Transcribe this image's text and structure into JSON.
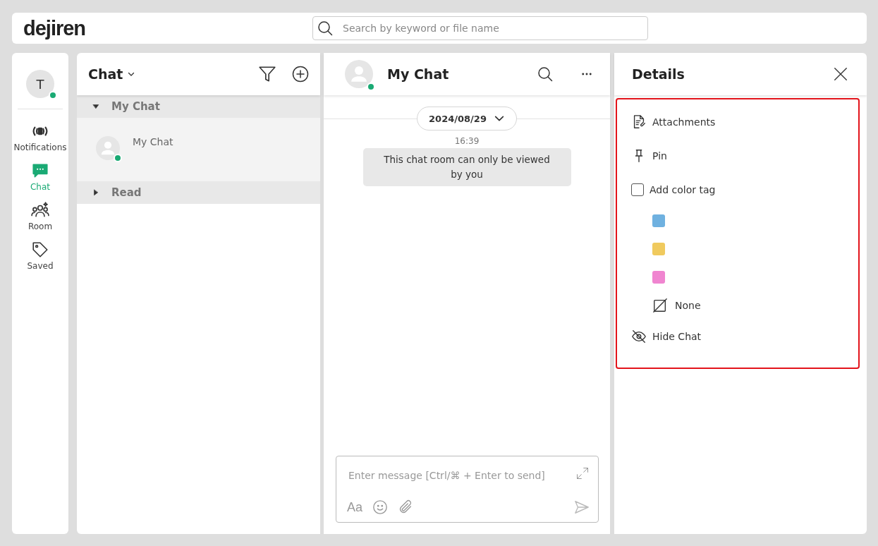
{
  "header": {
    "logo": "dejiren",
    "search": {
      "placeholder": "Search by keyword or file name"
    }
  },
  "nav": {
    "avatar": {
      "initial": "T",
      "online": true
    },
    "items": [
      {
        "kind": "notifications",
        "label": "Notifications",
        "selected": false
      },
      {
        "kind": "chat",
        "label": "Chat",
        "selected": true
      },
      {
        "kind": "room",
        "label": "Room",
        "selected": false
      },
      {
        "kind": "saved",
        "label": "Saved",
        "selected": false
      }
    ]
  },
  "chat_list": {
    "title": "Chat",
    "groups": [
      {
        "label": "My Chat",
        "expanded": true,
        "items": [
          {
            "name": "My Chat",
            "online": true,
            "selected": true
          }
        ]
      },
      {
        "label": "Read",
        "expanded": false
      }
    ]
  },
  "conversation": {
    "title": "My Chat",
    "online": true,
    "date": "2024/08/29",
    "messages": [
      {
        "time": "16:39",
        "text": "This chat room can only be viewed by you"
      }
    ],
    "composer": {
      "placeholder": "Enter message [Ctrl/⌘ + Enter to send]",
      "format_label": "Aa"
    }
  },
  "details": {
    "title": "Details",
    "highlighted": true,
    "items": [
      {
        "kind": "attachments",
        "label": "Attachments"
      },
      {
        "kind": "pin",
        "label": "Pin"
      },
      {
        "kind": "colortag",
        "label": "Add color tag",
        "checked": false,
        "tags": [
          {
            "color": "#6fb1e0"
          },
          {
            "color": "#f0ca5e"
          },
          {
            "color": "#f085d0"
          }
        ],
        "none_label": "None"
      },
      {
        "kind": "hide",
        "label": "Hide Chat"
      }
    ]
  }
}
